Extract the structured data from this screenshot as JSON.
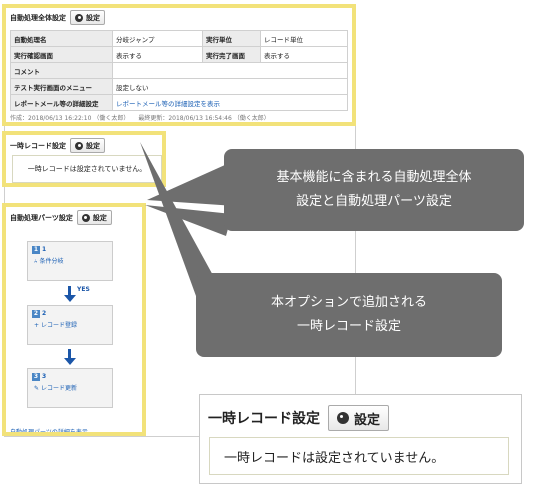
{
  "global_settings": {
    "title": "自動処理全体設定",
    "settings_button": "設定",
    "rows": [
      [
        "自動処理名",
        "分岐ジャンプ",
        "実行単位",
        "レコード単位"
      ],
      [
        "実行確認画面",
        "表示する",
        "実行完了画面",
        "表示する"
      ],
      [
        "コメント",
        ""
      ],
      [
        "テスト実行画面のメニュー",
        "設定しない"
      ],
      [
        "レポートメール等の詳細設定",
        "レポートメール等の詳細設定を表示"
      ]
    ],
    "meta": "作成：2018/06/13 16:22:10 （働く太郎）　　最終更新：2018/06/13 16:54:46 （働く太郎）"
  },
  "temp_record": {
    "title": "一時レコード設定",
    "settings_button": "設定",
    "message": "一時レコードは設定されていません。"
  },
  "parts": {
    "title": "自動処理パーツ設定",
    "settings_button": "設定",
    "cards": [
      {
        "num": "1",
        "name": "1",
        "sub": "条件分岐"
      },
      {
        "num": "2",
        "name": "2",
        "sub": "レコード登録"
      },
      {
        "num": "3",
        "name": "3",
        "sub": "レコード更新"
      }
    ],
    "yes_label": "YES",
    "detail_link": "自動処理パーツの詳細を表示"
  },
  "callouts": {
    "top": [
      "基本機能に含まれる自動処理全体",
      "設定と自動処理パーツ設定"
    ],
    "bottom": [
      "本オプションで追加される",
      "一時レコード設定"
    ]
  },
  "zoom": {
    "title": "一時レコード設定",
    "settings_button": "設定",
    "message": "一時レコードは設定されていません。"
  },
  "colors": {
    "highlight": "#f2e27a",
    "bubble": "#6e6e6e",
    "arrow": "#1b56a8",
    "link": "#1a5fb4"
  }
}
